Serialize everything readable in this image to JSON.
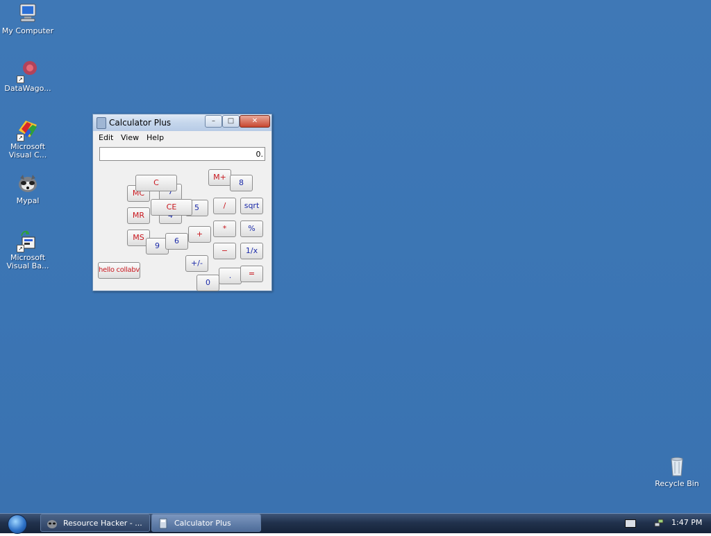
{
  "desktop": {
    "icons": [
      {
        "label": "My Computer",
        "icon": "computer-icon"
      },
      {
        "label": "DataWago...",
        "icon": "datawagon-icon"
      },
      {
        "label": "Microsoft\nVisual C...",
        "line1": "Microsoft",
        "line2": "Visual C...",
        "icon": "visual-c-icon"
      },
      {
        "label": "Mypal",
        "icon": "mypal-icon"
      },
      {
        "label": "Microsoft\nVisual Ba...",
        "line1": "Microsoft",
        "line2": "Visual Ba...",
        "icon": "visual-basic-icon"
      },
      {
        "label": "Recycle Bin",
        "icon": "recycle-bin-icon"
      }
    ]
  },
  "window": {
    "title": "Calculator Plus",
    "controls": {
      "minimize": "–",
      "maximize": "□",
      "close": "✕"
    },
    "menu": [
      "Edit",
      "View",
      "Help"
    ],
    "display_value": "0.",
    "keys": {
      "mc": "MC",
      "seven_hidden": "7",
      "c": "C",
      "ce": "CE",
      "four_hidden": "4",
      "mr": "MR",
      "five": "5",
      "ms": "MS",
      "nine": "9",
      "six": "6",
      "plus": "+",
      "mplus": "M+",
      "eight": "8",
      "divide": "/",
      "sqrt": "sqrt",
      "multiply": "*",
      "percent": "%",
      "minus": "−",
      "reciprocal": "1/x",
      "plusminus": "+/-",
      "zero": "0",
      "decimal": ".",
      "equals": "=",
      "hello": "hello collabvm"
    }
  },
  "taskbar": {
    "buttons": [
      {
        "label": "Resource Hacker - ...",
        "icon": "resource-hacker-icon"
      },
      {
        "label": "Calculator Plus",
        "icon": "calculator-icon"
      }
    ],
    "clock": "1:47 PM",
    "tray_icons": [
      "keyboard-icon",
      "network-icon"
    ]
  }
}
